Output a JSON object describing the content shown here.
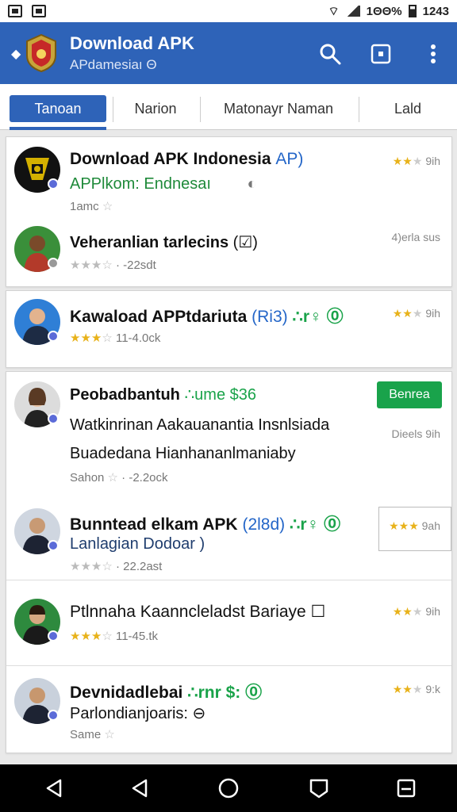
{
  "status_bar": {
    "battery_text": "1ΘΘ%",
    "time": "1243"
  },
  "app_bar": {
    "title": "Download APK",
    "subtitle": "APdamesiaı Θ"
  },
  "tabs": [
    {
      "label": "Tanoan",
      "active": true
    },
    {
      "label": "Narion",
      "active": false
    },
    {
      "label": "Matonayr Naman",
      "active": false
    },
    {
      "label": "Lald",
      "active": false
    }
  ],
  "apps": [
    {
      "name": "Download APK Indonesia",
      "name_extra": "AP)",
      "subtitle": "APPlkom: Endnesaı",
      "meta_text": "1amc",
      "rating_stars": 2.5,
      "rating_text": "9ih"
    },
    {
      "name": "Veheranlian tarlecins",
      "name_extra": "(☑)",
      "meta_text": "· -22sdt",
      "rating_stars": 3,
      "rating_text": "4)erla sus"
    },
    {
      "name": "Kawaload APPtdariuta",
      "name_blue": "(Ri3)",
      "name_green": "∴r♀ ⓪",
      "meta_text": "11-4.0ck",
      "rating_stars": 2.5,
      "rating_text": "9ih"
    },
    {
      "name": "Peobadbantuh",
      "name_green": "∴ume $36",
      "desc_line1": "Watkinrinan Aakauanantia Insnlsiada",
      "desc_line2": "Buadedana Hianhananlmaniaby",
      "meta_text": "Sahon",
      "meta_text2": "· -2.2ock",
      "button_label": "Benrea",
      "rating_text": "Dieels 9ih"
    },
    {
      "name": "Bunntead elkam APK",
      "name_blue": "(2l8d)",
      "name_green": "∴r♀ ⓪",
      "subtitle": "Lanlagian Dodoar )",
      "meta_text": "· 22.2ast",
      "rating_stars": 2.5,
      "rating_text": "9ah"
    },
    {
      "name": "Ptlnnaha Kaanncleladst Bariaye",
      "name_extra": "☐",
      "meta_text": "11-45.tk",
      "rating_stars": 2.5,
      "rating_text": "9ih"
    },
    {
      "name": "Devnidadlebai",
      "name_green": "∴rnr $: ⓪",
      "subtitle": "Parlondianjoaris: ⊖",
      "meta_text": "Same",
      "rating_stars": 2.5,
      "rating_text": "9:k"
    }
  ],
  "colors": {
    "primary": "#2e63b8",
    "green": "#19a34b",
    "star": "#e8b21a"
  }
}
